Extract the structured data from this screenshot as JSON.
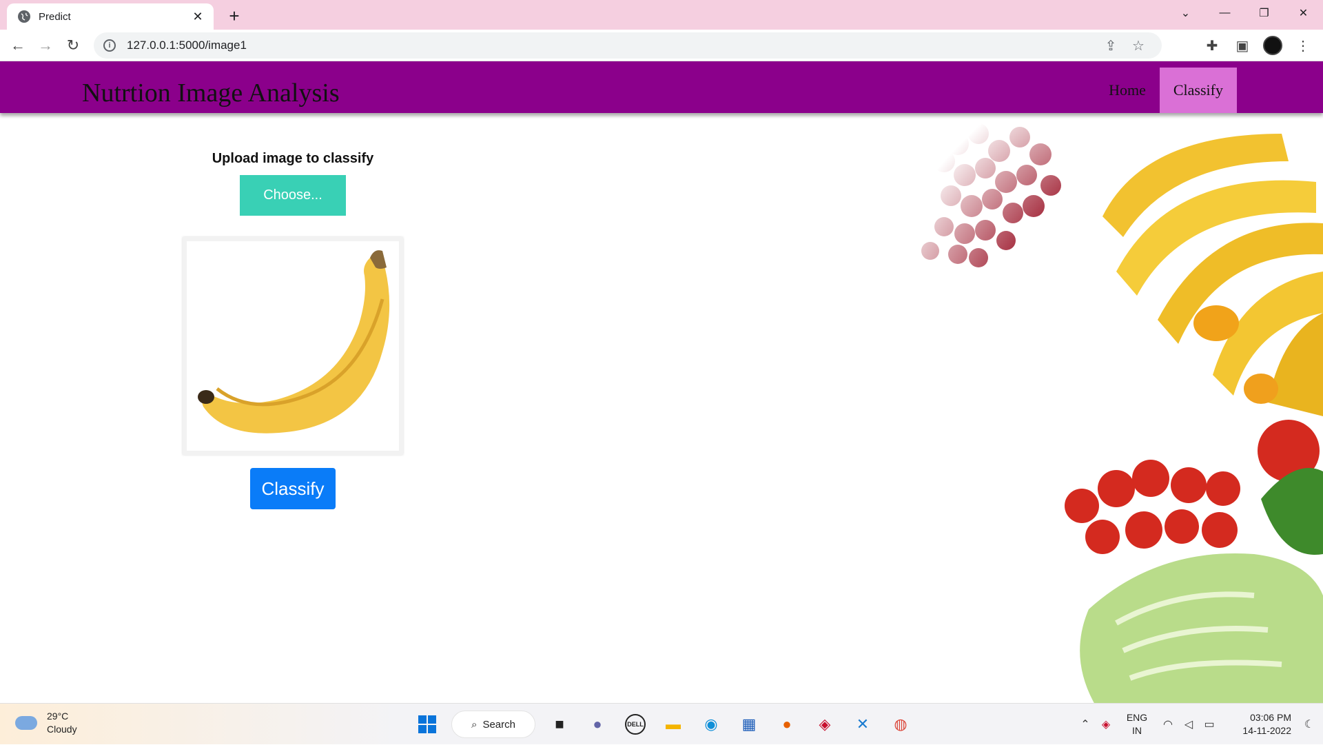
{
  "browser": {
    "tab_title": "Predict",
    "new_tab_symbol": "+",
    "url": "127.0.0.1:5000/image1"
  },
  "site": {
    "brand": "Nutrtion Image Analysis",
    "nav": [
      {
        "label": "Home",
        "active": false
      },
      {
        "label": "Classify",
        "active": true
      }
    ],
    "colors": {
      "navbar": "#8b008b",
      "active_nav": "#da70d6",
      "choose_button": "#39d0b5",
      "classify_button": "#0a7cf8"
    }
  },
  "upload": {
    "label": "Upload image to classify",
    "choose_label": "Choose...",
    "preview_image": "banana",
    "classify_label": "Classify"
  },
  "taskbar": {
    "weather_temp": "29°C",
    "weather_desc": "Cloudy",
    "search_label": "Search",
    "lang_1": "ENG",
    "lang_2": "IN",
    "time": "03:06 PM",
    "date": "14-11-2022"
  }
}
